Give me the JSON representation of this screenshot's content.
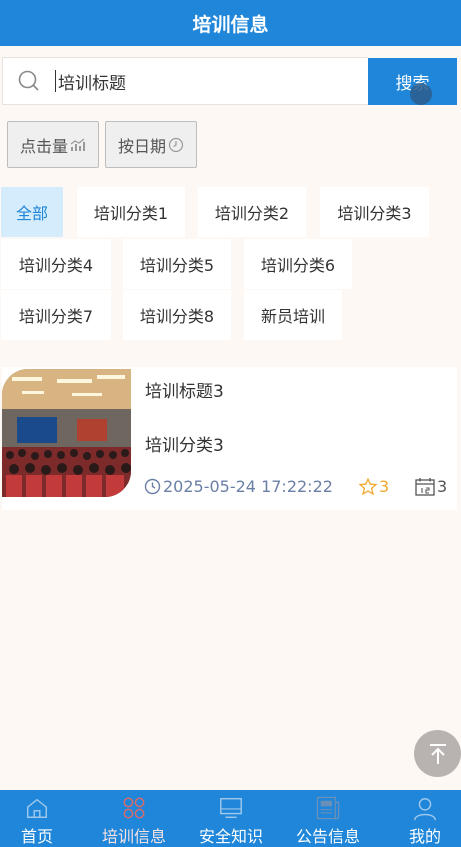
{
  "header": {
    "title": "培训信息"
  },
  "search": {
    "value": "培训标题",
    "button_label": "搜索"
  },
  "sort": {
    "hits_label": "点击量",
    "date_label": "按日期"
  },
  "categories": [
    "全部",
    "培训分类1",
    "培训分类2",
    "培训分类3",
    "培训分类4",
    "培训分类5",
    "培训分类6",
    "培训分类7",
    "培训分类8",
    "新员培训"
  ],
  "active_category": "全部",
  "items": [
    {
      "title": "培训标题3",
      "category": "培训分类3",
      "datetime": "2025-05-24 17:22:22",
      "favorites": "3",
      "days": "3"
    }
  ],
  "tabbar": {
    "items": [
      {
        "label": "首页",
        "icon": "home-icon"
      },
      {
        "label": "培训信息",
        "icon": "grid-icon"
      },
      {
        "label": "安全知识",
        "icon": "monitor-icon"
      },
      {
        "label": "公告信息",
        "icon": "newspaper-icon"
      },
      {
        "label": "我的",
        "icon": "user-icon"
      }
    ],
    "active_index": 1
  },
  "colors": {
    "primary": "#1f86d9",
    "accent": "#f0a830",
    "active_category_bg": "#d4ecfb"
  }
}
